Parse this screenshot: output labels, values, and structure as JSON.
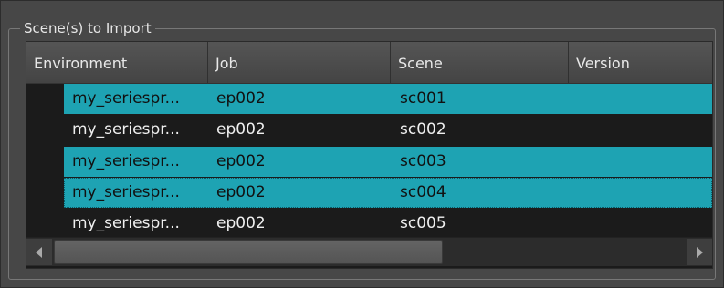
{
  "group": {
    "title": "Scene(s) to Import"
  },
  "table": {
    "columns": [
      "Environment",
      "Job",
      "Scene",
      "Version"
    ],
    "rows": [
      {
        "environment": "my_seriespr...",
        "job": "ep002",
        "scene": "sc001",
        "version": "",
        "selected": true
      },
      {
        "environment": "my_seriespr...",
        "job": "ep002",
        "scene": "sc002",
        "version": "",
        "selected": false
      },
      {
        "environment": "my_seriespr...",
        "job": "ep002",
        "scene": "sc003",
        "version": "",
        "selected": true
      },
      {
        "environment": "my_seriespr...",
        "job": "ep002",
        "scene": "sc004",
        "version": "",
        "selected": true,
        "focused": true
      },
      {
        "environment": "my_seriespr...",
        "job": "ep002",
        "scene": "sc005",
        "version": "",
        "selected": false
      }
    ]
  },
  "scrollbar": {
    "left_icon": "arrow-left-icon",
    "right_icon": "arrow-right-icon",
    "position": 0
  },
  "colors": {
    "selection": "#1ea3b3",
    "background": "#474747",
    "table_bg": "#1b1b1b"
  }
}
